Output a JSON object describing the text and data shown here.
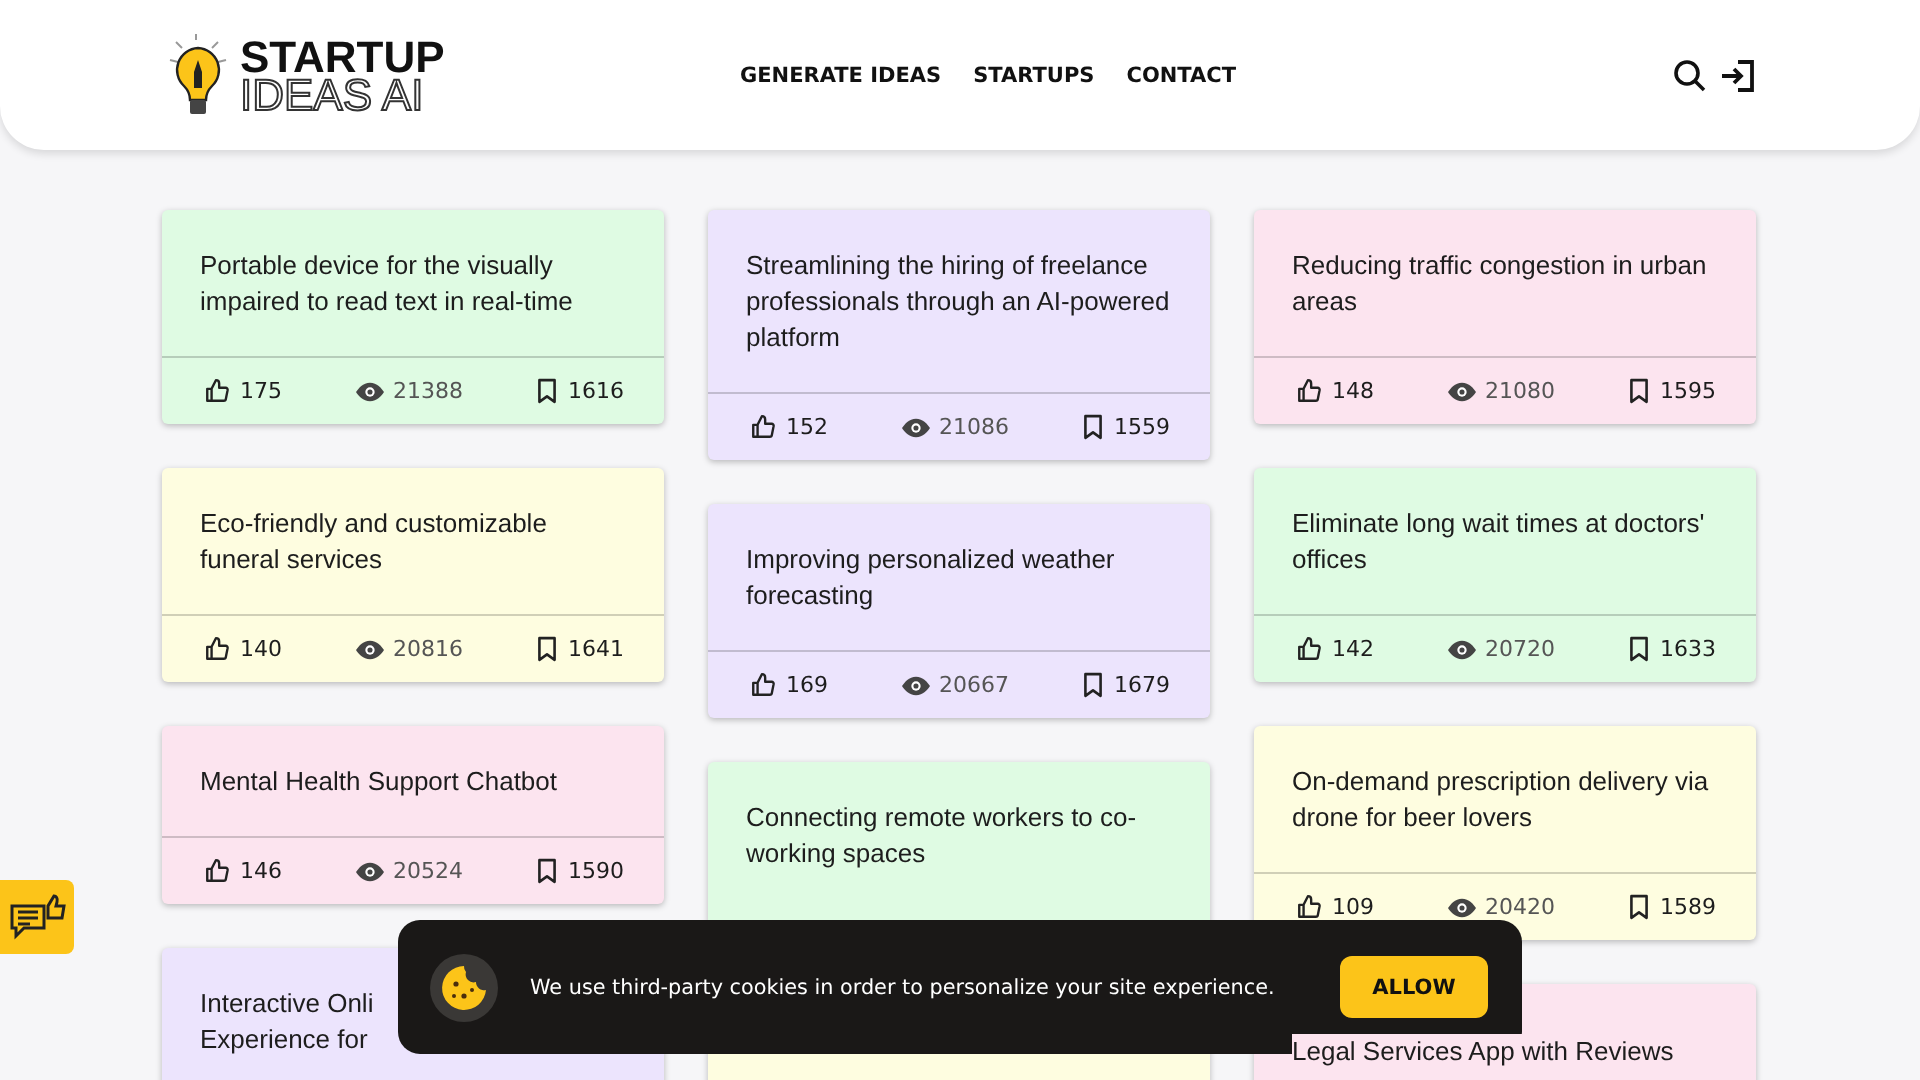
{
  "logo": {
    "line_1": "STARTUP",
    "line_2": "IDEAS AI"
  },
  "nav": [
    "GENERATE IDEAS",
    "STARTUPS",
    "CONTACT"
  ],
  "columns": [
    {
      "cards": [
        {
          "title": "Portable device for the visually impaired to read text in real-time",
          "color": "#dffbe3",
          "likes": "175",
          "views": "21388",
          "saves": "1616"
        },
        {
          "title": "Eco-friendly and customizable funeral services",
          "color": "#fefde0",
          "likes": "140",
          "views": "20816",
          "saves": "1641"
        },
        {
          "title": "Mental Health Support Chatbot",
          "color": "#fce4ef",
          "likes": "146",
          "views": "20524",
          "saves": "1590"
        },
        {
          "title_lines": [
            "Interactive Onli",
            "Experience for"
          ],
          "color": "#ece4fd"
        }
      ]
    },
    {
      "cards": [
        {
          "title": "Streamlining the hiring of freelance professionals through an AI-powered platform",
          "color": "#ece4fd",
          "likes": "152",
          "views": "21086",
          "saves": "1559"
        },
        {
          "title": "Improving personalized weather forecasting",
          "color": "#ece4fd",
          "likes": "169",
          "views": "20667",
          "saves": "1679"
        },
        {
          "title": "Connecting remote workers to co-working spaces",
          "color": "#dffbe3"
        },
        {
          "color": "#fefde0"
        }
      ]
    },
    {
      "cards": [
        {
          "title": "Reducing traffic congestion in urban areas",
          "color": "#fce4ef",
          "likes": "148",
          "views": "21080",
          "saves": "1595"
        },
        {
          "title": "Eliminate long wait times at doctors' offices",
          "color": "#dffbe3",
          "likes": "142",
          "views": "20720",
          "saves": "1633"
        },
        {
          "title": "On-demand prescription delivery via drone for beer lovers",
          "color": "#fefde0",
          "likes": "109",
          "views": "20420",
          "saves": "1589"
        },
        {
          "title": "Legal Services App with Reviews",
          "color": "#fce4ef"
        }
      ]
    }
  ],
  "cookie_banner": {
    "message": "We use third-party cookies in order to personalize your site experience.",
    "button": "ALLOW"
  }
}
